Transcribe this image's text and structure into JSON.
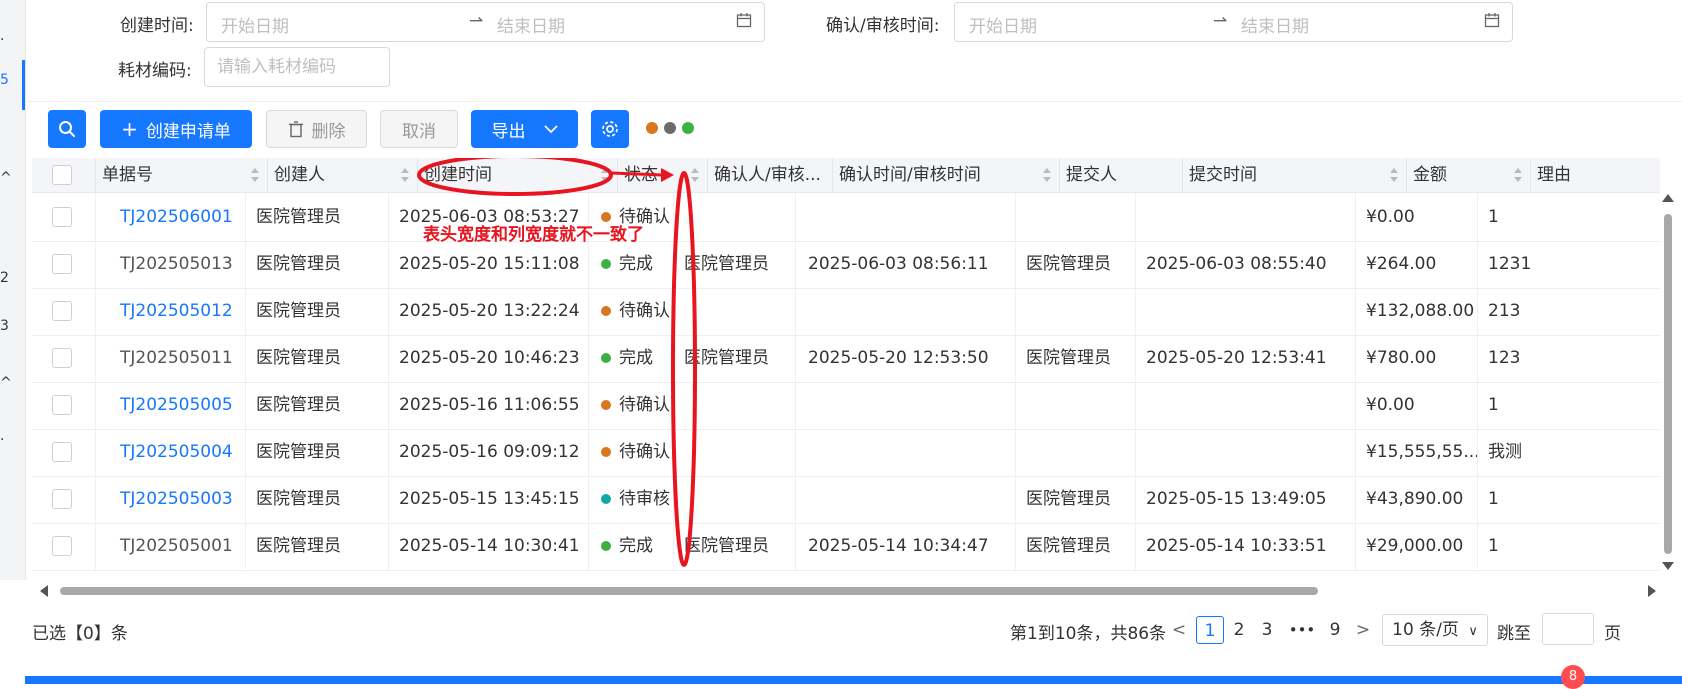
{
  "filters": {
    "created_time_label": "创建时间:",
    "confirm_time_label": "确认/审核时间:",
    "material_code_label": "耗材编码:",
    "start_placeholder": "开始日期",
    "end_placeholder": "结束日期",
    "material_code_placeholder": "请输入耗材编码"
  },
  "left_marks": [
    ".",
    "5",
    "^",
    "2",
    "3",
    "^",
    "."
  ],
  "toolbar": {
    "create_label": "创建申请单",
    "delete_label": "删除",
    "cancel_label": "取消",
    "export_label": "导出",
    "dot_colors": [
      "#d9771f",
      "#6b6b6b",
      "#3cb043"
    ]
  },
  "table": {
    "columns": [
      "单据号",
      "创建人",
      "创建时间",
      "状态",
      "确认人/审核...",
      "确认时间/审核时间",
      "提交人",
      "提交时间",
      "金额",
      "理由"
    ],
    "rows": [
      {
        "id": "TJ202506001",
        "link": true,
        "creator": "医院管理员",
        "created": "2025-06-03 08:53:27",
        "status": "待确认",
        "status_color": "#d9771f",
        "confirmer": "",
        "confirm_time": "",
        "submitter": "",
        "submit_time": "",
        "amount": "¥0.00",
        "reason": "1"
      },
      {
        "id": "TJ202505013",
        "link": false,
        "creator": "医院管理员",
        "created": "2025-05-20 15:11:08",
        "status": "完成",
        "status_color": "#3cb043",
        "confirmer": "医院管理员",
        "confirm_time": "2025-06-03 08:56:11",
        "submitter": "医院管理员",
        "submit_time": "2025-06-03 08:55:40",
        "amount": "¥264.00",
        "reason": "1231"
      },
      {
        "id": "TJ202505012",
        "link": true,
        "creator": "医院管理员",
        "created": "2025-05-20 13:22:24",
        "status": "待确认",
        "status_color": "#d9771f",
        "confirmer": "",
        "confirm_time": "",
        "submitter": "",
        "submit_time": "",
        "amount": "¥132,088.00",
        "reason": "213"
      },
      {
        "id": "TJ202505011",
        "link": false,
        "creator": "医院管理员",
        "created": "2025-05-20 10:46:23",
        "status": "完成",
        "status_color": "#3cb043",
        "confirmer": "医院管理员",
        "confirm_time": "2025-05-20 12:53:50",
        "submitter": "医院管理员",
        "submit_time": "2025-05-20 12:53:41",
        "amount": "¥780.00",
        "reason": "123"
      },
      {
        "id": "TJ202505005",
        "link": true,
        "creator": "医院管理员",
        "created": "2025-05-16 11:06:55",
        "status": "待确认",
        "status_color": "#d9771f",
        "confirmer": "",
        "confirm_time": "",
        "submitter": "",
        "submit_time": "",
        "amount": "¥0.00",
        "reason": "1"
      },
      {
        "id": "TJ202505004",
        "link": true,
        "creator": "医院管理员",
        "created": "2025-05-16 09:09:12",
        "status": "待确认",
        "status_color": "#d9771f",
        "confirmer": "",
        "confirm_time": "",
        "submitter": "",
        "submit_time": "",
        "amount": "¥15,555,55...",
        "reason": "我测"
      },
      {
        "id": "TJ202505003",
        "link": true,
        "creator": "医院管理员",
        "created": "2025-05-15 13:45:15",
        "status": "待审核",
        "status_color": "#13a8a8",
        "confirmer": "",
        "confirm_time": "",
        "submitter": "医院管理员",
        "submit_time": "2025-05-15 13:49:05",
        "amount": "¥43,890.00",
        "reason": "1"
      },
      {
        "id": "TJ202505001",
        "link": false,
        "creator": "医院管理员",
        "created": "2025-05-14 10:30:41",
        "status": "完成",
        "status_color": "#3cb043",
        "confirmer": "医院管理员",
        "confirm_time": "2025-05-14 10:34:47",
        "submitter": "医院管理员",
        "submit_time": "2025-05-14 10:33:51",
        "amount": "¥29,000.00",
        "reason": "1"
      }
    ]
  },
  "annotation": {
    "text": "表头宽度和列宽度就不一致了"
  },
  "footer": {
    "selected": "已选【0】条",
    "range": "第1到10条，共86条",
    "pages": [
      "1",
      "2",
      "3",
      "•••",
      "9"
    ],
    "current_page": "1",
    "page_size": "10 条/页",
    "jump_label": "跳至",
    "page_suffix": "页",
    "badge": "8"
  }
}
